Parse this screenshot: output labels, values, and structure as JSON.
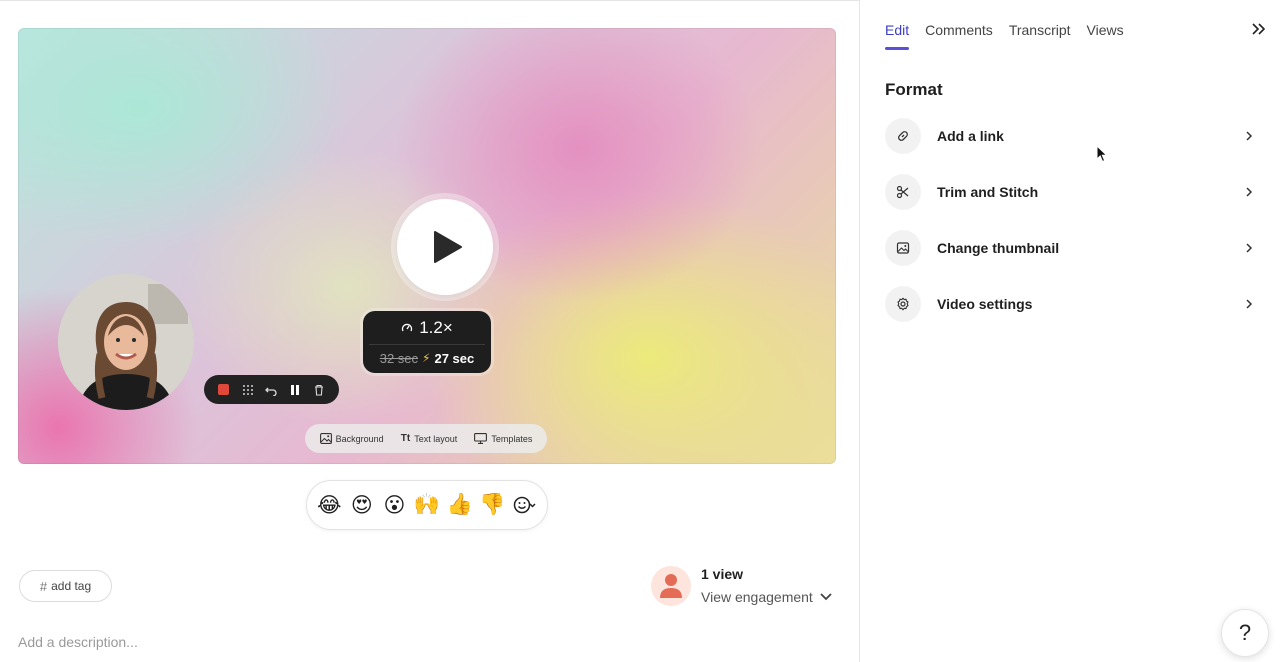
{
  "video": {
    "speed": {
      "rate": "1.2×",
      "original_duration": "32 sec",
      "new_duration": "27 sec"
    },
    "tools": [
      {
        "label": "Background",
        "icon": "image-icon"
      },
      {
        "label": "Text layout",
        "icon": "text-layout-icon"
      },
      {
        "label": "Templates",
        "icon": "monitor-icon"
      }
    ],
    "recorder_toolbar": [
      "stop-record-icon",
      "grid-icon",
      "undo-icon",
      "pause-icon",
      "trash-icon"
    ]
  },
  "reactions": [
    "😂",
    "😍",
    "😮",
    "🙌",
    "👍",
    "👎"
  ],
  "tag": {
    "hash": "#",
    "label": "add tag"
  },
  "views": {
    "count": "1 view",
    "engagement": "View engagement"
  },
  "description": {
    "placeholder": "Add a description..."
  },
  "sidebar": {
    "tabs": [
      {
        "label": "Edit",
        "active": true
      },
      {
        "label": "Comments",
        "active": false
      },
      {
        "label": "Transcript",
        "active": false
      },
      {
        "label": "Views",
        "active": false
      }
    ],
    "section_title": "Format",
    "items": [
      {
        "label": "Add a link",
        "icon": "link-icon"
      },
      {
        "label": "Trim and Stitch",
        "icon": "scissors-icon"
      },
      {
        "label": "Change thumbnail",
        "icon": "image-icon"
      },
      {
        "label": "Video settings",
        "icon": "gear-icon"
      }
    ]
  },
  "help": {
    "label": "?"
  },
  "colors": {
    "accent": "#5a50d8",
    "record": "#e0483a"
  }
}
